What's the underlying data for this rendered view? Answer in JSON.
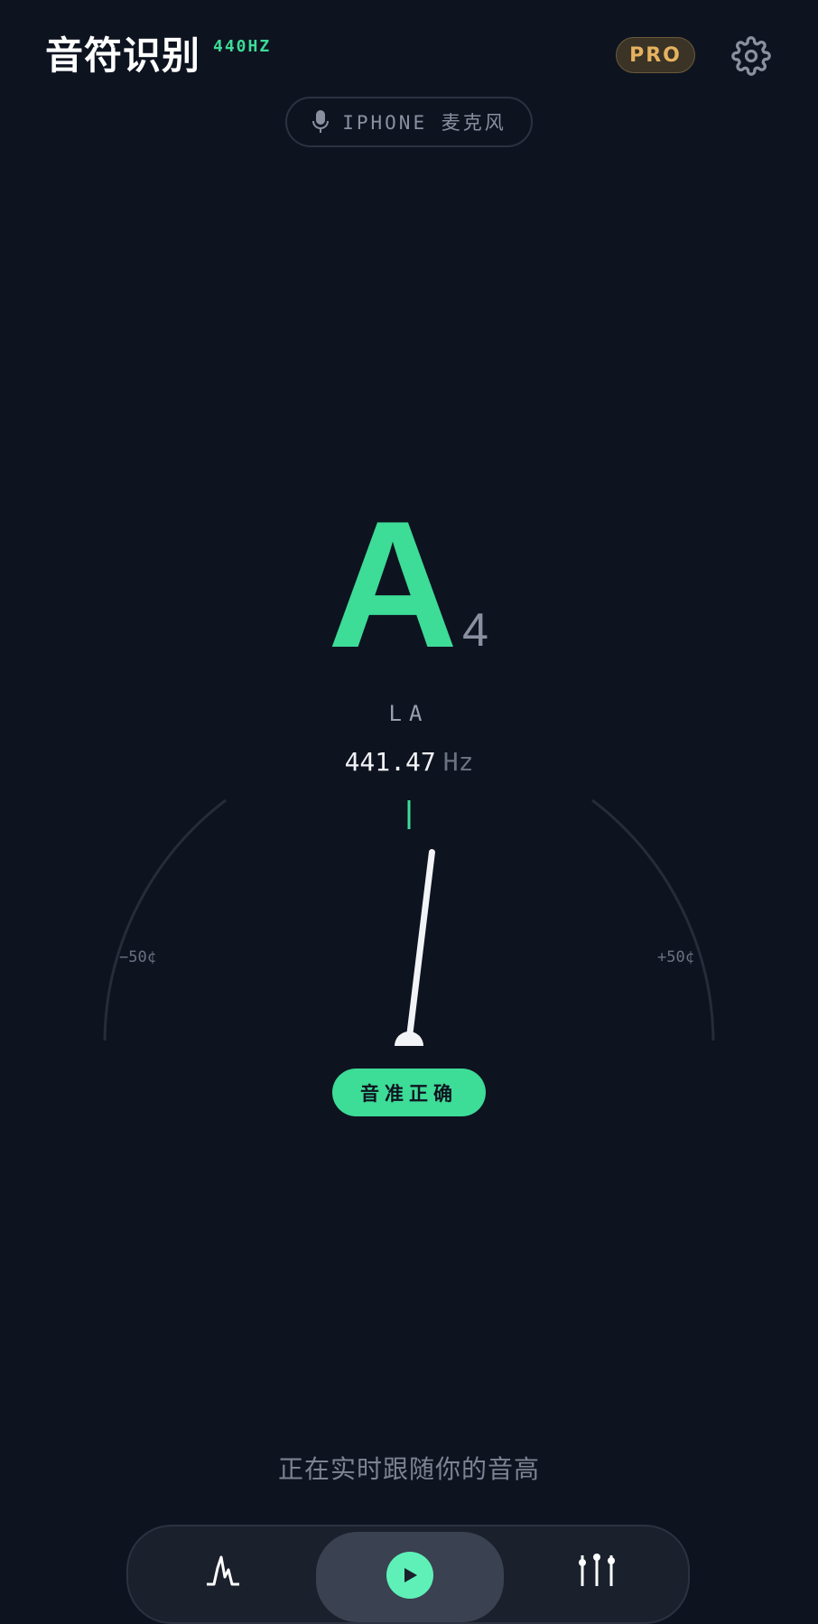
{
  "header": {
    "title": "音符识别",
    "reference_pitch": "440HZ",
    "pro_label": "PRO",
    "settings_icon": "gear-icon"
  },
  "input_source": {
    "icon": "microphone-icon",
    "label": "IPHONE 麦克风"
  },
  "tuner": {
    "note": "A",
    "octave": "4",
    "solfege": "LA",
    "frequency": "441.47",
    "frequency_unit": "Hz",
    "cents_min_label": "−50¢",
    "cents_max_label": "+50¢",
    "cents_offset": 5.8,
    "status": "音准正确"
  },
  "hint": "正在实时跟随你的音高",
  "tabbar": {
    "tabs": [
      {
        "icon": "waveform-icon",
        "active": false
      },
      {
        "icon": "tuner-play-icon",
        "active": true
      },
      {
        "icon": "sliders-icon",
        "active": false
      }
    ]
  },
  "colors": {
    "background": "#0e1320",
    "accent": "#3ddc97",
    "pro": "#e7b25f",
    "muted": "#6b7282"
  }
}
